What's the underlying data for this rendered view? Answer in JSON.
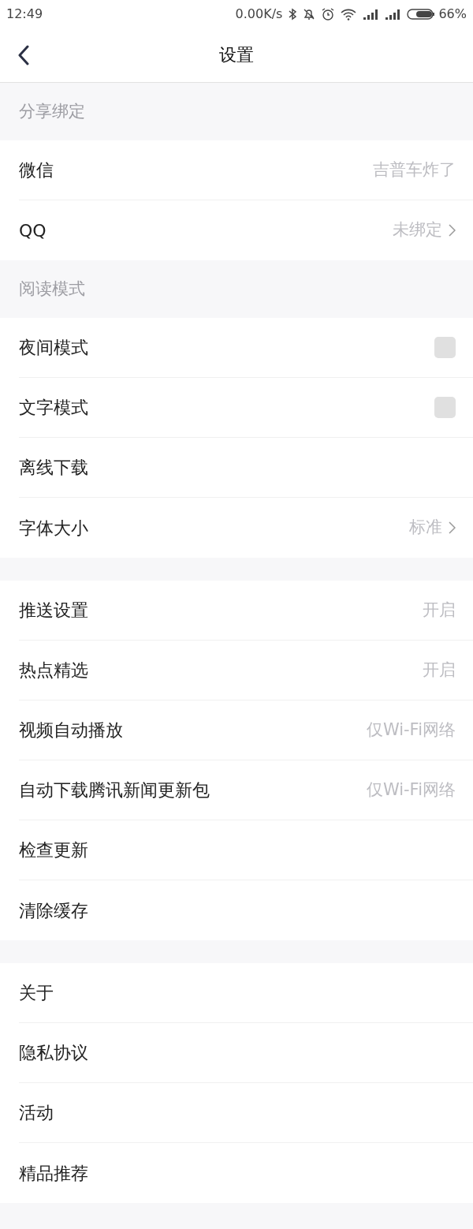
{
  "status_bar": {
    "time": "12:49",
    "speed": "0.00K/s",
    "battery": "66%"
  },
  "header": {
    "title": "设置"
  },
  "sections": [
    {
      "title": "分享绑定",
      "items": [
        {
          "label": "微信",
          "kind": "value",
          "value": "吉普车炸了"
        },
        {
          "label": "QQ",
          "kind": "link",
          "value": "未绑定"
        }
      ]
    },
    {
      "title": "阅读模式",
      "items": [
        {
          "label": "夜间模式",
          "kind": "checkbox",
          "checked": false
        },
        {
          "label": "文字模式",
          "kind": "checkbox",
          "checked": false
        },
        {
          "label": "离线下载",
          "kind": "plain"
        },
        {
          "label": "字体大小",
          "kind": "link",
          "value": "标准"
        }
      ]
    },
    {
      "items": [
        {
          "label": "推送设置",
          "kind": "value",
          "value": "开启"
        },
        {
          "label": "热点精选",
          "kind": "value",
          "value": "开启"
        },
        {
          "label": "视频自动播放",
          "kind": "value",
          "value": "仅Wi-Fi网络"
        },
        {
          "label": "自动下载腾讯新闻更新包",
          "kind": "value",
          "value": "仅Wi-Fi网络"
        },
        {
          "label": "检查更新",
          "kind": "plain"
        },
        {
          "label": "清除缓存",
          "kind": "plain"
        }
      ]
    },
    {
      "items": [
        {
          "label": "关于",
          "kind": "plain"
        },
        {
          "label": "隐私协议",
          "kind": "plain"
        },
        {
          "label": "活动",
          "kind": "plain"
        },
        {
          "label": "精品推荐",
          "kind": "plain"
        }
      ]
    }
  ]
}
